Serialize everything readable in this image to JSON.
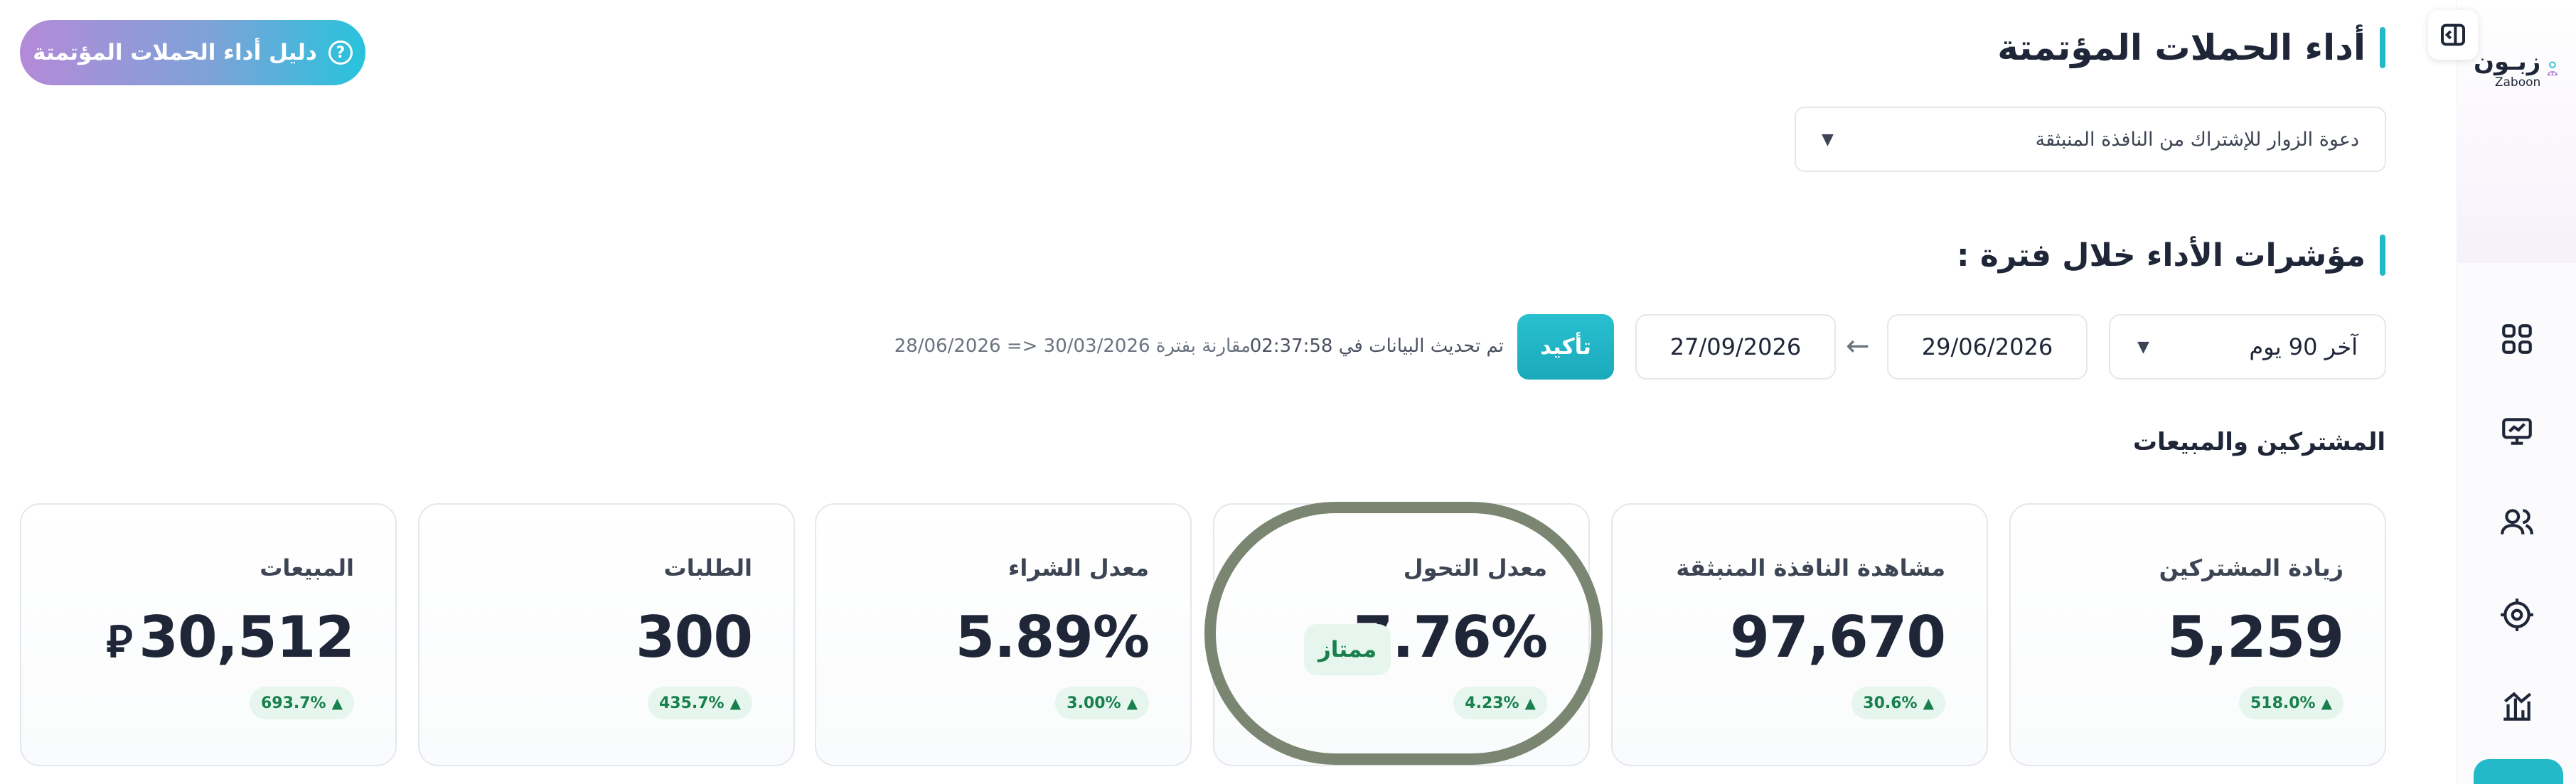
{
  "sidebar": {
    "logo_ar": "زبـون",
    "logo_en": "Zaboon",
    "icons": [
      "grid-icon",
      "presentation-chart-icon",
      "users-icon",
      "target-icon",
      "bar-chart-icon"
    ]
  },
  "header": {
    "title": "أداء الحملات المؤتمتة",
    "guide_button": "دليل أداء الحملات المؤتمتة",
    "campaign_select_value": "دعوة الزوار للإشتراك من النافذة المنبثقة"
  },
  "kpi": {
    "title": "مؤشرات الأداء خلال فترة :",
    "period_select_value": "آخر 90 يوم",
    "date_from": "29/06/2026",
    "date_to": "27/09/2026",
    "confirm_label": "تأكيد",
    "updated_text": "تم تحديث البيانات في 02:37:58",
    "compare_text": "مقارنة بفترة 30/03/2026 <= 28/06/2026"
  },
  "subscribers_section": {
    "title": "المشتركين والمبيعات",
    "cards": [
      {
        "label": "زيادة المشتركين",
        "value": "5,259",
        "change": "518.0%"
      },
      {
        "label": "مشاهدة النافذة المنبثقة",
        "value": "97,670",
        "change": "30.6%"
      },
      {
        "label": "معدل التحول",
        "value": "7.76%",
        "change": "4.23%",
        "badge": "ممتاز"
      },
      {
        "label": "معدل الشراء",
        "value": "5.89%",
        "change": "3.00%"
      },
      {
        "label": "الطلبات",
        "value": "300",
        "change": "435.7%"
      },
      {
        "label": "المبيعات",
        "value": "30,512",
        "change": "693.7%",
        "currency_symbol": "⃁"
      }
    ]
  },
  "colors": {
    "accent": "#23b9c9",
    "text_dark": "#1f2638",
    "success_bg": "#e6f6ee",
    "success_text": "#17804c",
    "highlight_ring": "#7b8672"
  }
}
